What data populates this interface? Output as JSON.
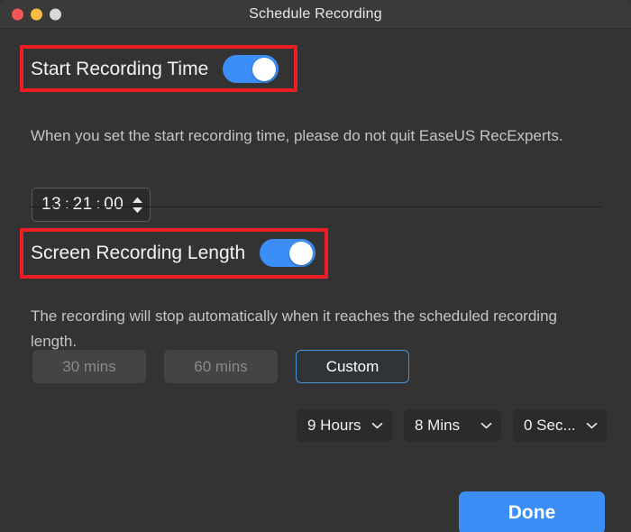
{
  "window": {
    "title": "Schedule Recording",
    "traffic_lights": [
      {
        "name": "close",
        "color": "#f4575a"
      },
      {
        "name": "minimize",
        "color": "#f9bc40"
      },
      {
        "name": "maximize",
        "color": "#d8d8d8"
      }
    ]
  },
  "start_recording": {
    "label": "Start Recording Time",
    "toggle_state": "on",
    "description": "When you set the start recording time, please do not quit EaseUS RecExperts.",
    "time": {
      "hours": "13",
      "minutes": "21",
      "seconds": "00",
      "separator": ":"
    }
  },
  "recording_length": {
    "label": "Screen Recording Length",
    "toggle_state": "on",
    "description": "The recording will stop automatically when it reaches the scheduled recording length.",
    "presets": [
      {
        "label": "30 mins",
        "state": "disabled"
      },
      {
        "label": "60 mins",
        "state": "disabled"
      },
      {
        "label": "Custom",
        "state": "selected"
      }
    ],
    "duration": {
      "hours": "9 Hours",
      "minutes": "8 Mins",
      "seconds": "0 Sec..."
    }
  },
  "footer": {
    "done_label": "Done"
  },
  "colors": {
    "accent_blue": "#3b8ef5",
    "annotation_red": "#ee1c25",
    "window_bg": "#333333",
    "titlebar_bg": "#3a3a3a",
    "selected_border": "#4a90d9"
  }
}
